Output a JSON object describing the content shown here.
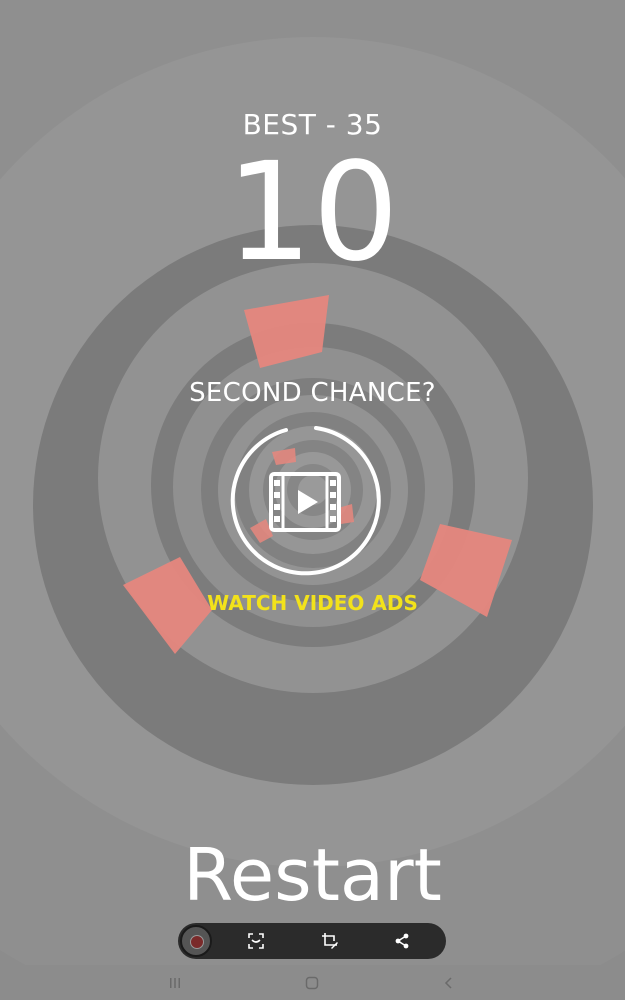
{
  "game": {
    "best_label": "BEST - 35",
    "score": "10",
    "second_chance_label": "SECOND CHANCE?",
    "watch_ads_label": "WATCH VIDEO ADS",
    "restart_label": "Restart"
  },
  "colors": {
    "background": "#8c8c8c",
    "ring_dark": "#7b7b7b",
    "ring_light": "#959595",
    "segment": "#e8877e",
    "text": "#ffffff",
    "ads_text": "#f2e21b",
    "toolbar": "#2b2b2b"
  },
  "icons": {
    "video_play": "film-play-icon",
    "scan": "scan-icon",
    "crop_edit": "crop-edit-icon",
    "share": "share-icon",
    "nav_recents": "recents-icon",
    "nav_home": "home-icon",
    "nav_back": "back-icon"
  }
}
